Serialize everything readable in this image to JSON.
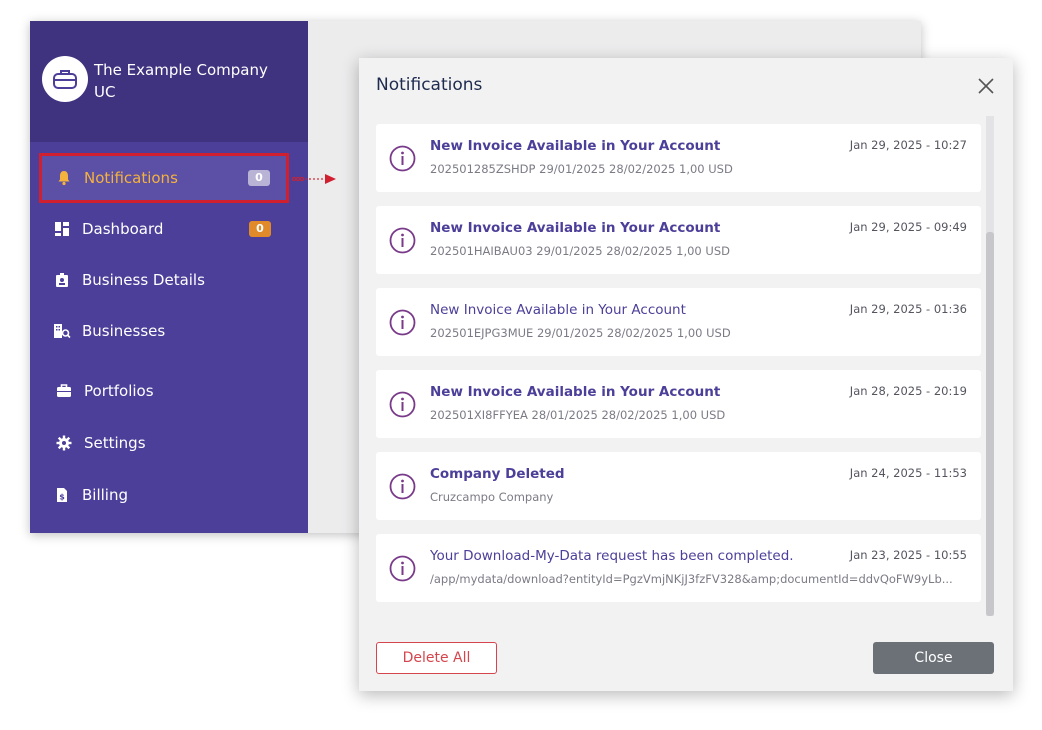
{
  "company": {
    "name": "The Example Company UC"
  },
  "sidebar": {
    "items": [
      {
        "label": "Notifications",
        "badge": "0",
        "icon": "bell-icon"
      },
      {
        "label": "Dashboard",
        "badge": "0",
        "icon": "dashboard-icon"
      },
      {
        "label": "Business Details",
        "icon": "id-badge-icon"
      },
      {
        "label": "Businesses",
        "icon": "building-search-icon"
      },
      {
        "label": "Portfolios",
        "icon": "briefcase-icon"
      },
      {
        "label": "Settings",
        "icon": "gear-icon"
      },
      {
        "label": "Billing",
        "icon": "bill-icon"
      }
    ]
  },
  "modal": {
    "title": "Notifications",
    "notifications": [
      {
        "title": "New Invoice Available in Your Account",
        "subtitle": "202501285ZSHDP 29/01/2025 28/02/2025 1,00 USD",
        "date": "Jan 29, 2025 - 10:27",
        "unread": true
      },
      {
        "title": "New Invoice Available in Your Account",
        "subtitle": "202501HAIBAU03 29/01/2025 28/02/2025 1,00 USD",
        "date": "Jan 29, 2025 - 09:49",
        "unread": true
      },
      {
        "title": "New Invoice Available in Your Account",
        "subtitle": "202501EJPG3MUE 29/01/2025 28/02/2025 1,00 USD",
        "date": "Jan 29, 2025 - 01:36",
        "unread": false
      },
      {
        "title": "New Invoice Available in Your Account",
        "subtitle": "202501XI8FFYEA 28/01/2025 28/02/2025 1,00 USD",
        "date": "Jan 28, 2025 - 20:19",
        "unread": true
      },
      {
        "title": "Company Deleted",
        "subtitle": "Cruzcampo Company",
        "date": "Jan 24, 2025 - 11:53",
        "unread": true
      },
      {
        "title": "Your Download-My-Data request has been completed.",
        "subtitle": "/app/mydata/download?entityId=PgzVmjNKjJ3fzFV328&amp;documentId=ddvQoFW9yLb...",
        "date": "Jan 23, 2025 - 10:55",
        "unread": false
      }
    ],
    "delete_all_label": "Delete All",
    "close_label": "Close"
  },
  "colors": {
    "sidebar": "#4b3f99",
    "highlight_border": "#d02030",
    "active_text": "#f5b23d",
    "accent": "#4b3f99"
  }
}
